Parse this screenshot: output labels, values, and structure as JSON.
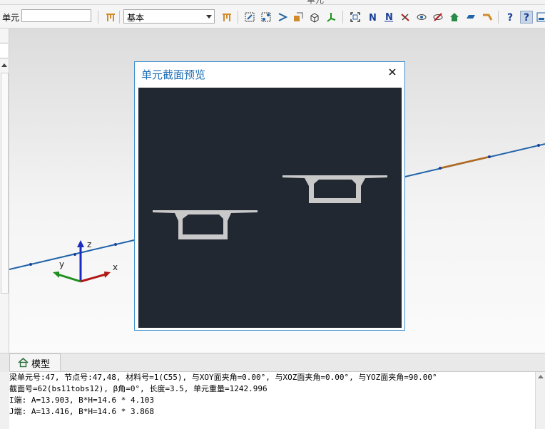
{
  "window": {
    "title": "单元"
  },
  "toolbar": {
    "element_label": "单元",
    "element_value": "",
    "mode_value": "基本",
    "icons": [
      "table-icon",
      "select-element-icon",
      "select-node-icon",
      "select-path-icon",
      "box-select-icon",
      "section-3d-icon",
      "axis-icon",
      "zoom-fit-icon",
      "node-number-icon",
      "element-number-icon",
      "hide-icon",
      "show-all-icon",
      "eye-slash-icon",
      "home-view-icon",
      "plane-icon",
      "pipe-icon",
      "help-icon",
      "help-context-icon",
      "layout-icon"
    ]
  },
  "dialog": {
    "title": "单元截面预览",
    "close_symbol": "✕"
  },
  "bottom_tab": {
    "label": "模型"
  },
  "output": {
    "lines": [
      "梁单元号:47, 节点号:47,48, 材料号=1(C55), 与XOY面夹角=0.00°, 与XOZ面夹角=0.00°, 与YOZ面夹角=90.00°",
      "截面号=62(bs11tobs12), β角=0°, 长度=3.5, 单元重量=1242.996",
      "I端: A=13.903, B*H=14.6 * 4.103",
      "J端: A=13.416, B*H=14.6 * 3.868"
    ]
  },
  "axes": {
    "z": "z",
    "y": "y",
    "x": "x"
  },
  "colors": {
    "beam": "#1f63a8",
    "selected_segment": "#b26a1d",
    "axis_z": "#1b2bc2",
    "axis_y": "#1d8f1d",
    "axis_x": "#b11818"
  }
}
